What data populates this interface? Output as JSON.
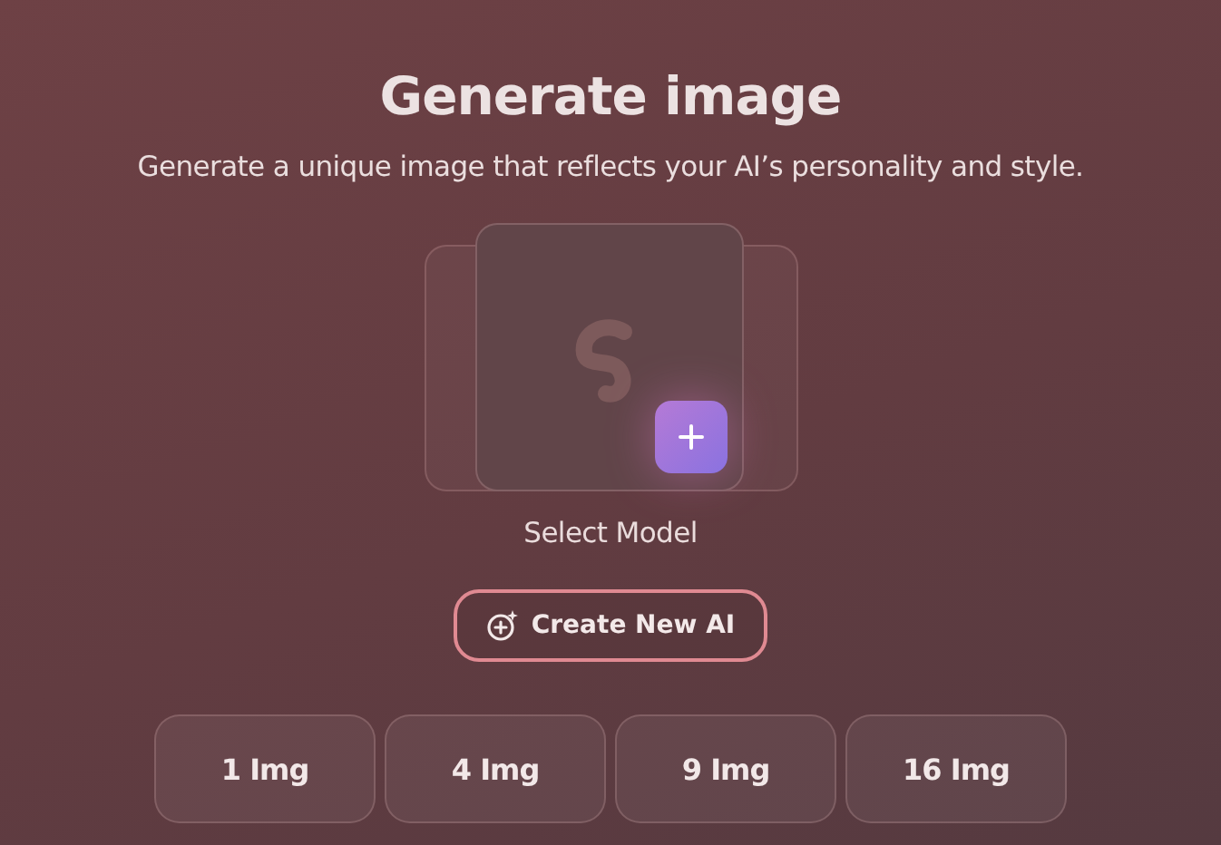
{
  "title": "Generate image",
  "subtitle": "Generate a unique image that reflects your AI’s personality and style.",
  "model_picker": {
    "label": "Select Model"
  },
  "create_button": {
    "label": "Create New AI"
  },
  "image_counts": [
    {
      "label": "1 Img",
      "selected": false
    },
    {
      "label": "4 Img",
      "selected": false
    },
    {
      "label": "9 Img",
      "selected": false
    },
    {
      "label": "16 Img",
      "selected": false
    }
  ]
}
